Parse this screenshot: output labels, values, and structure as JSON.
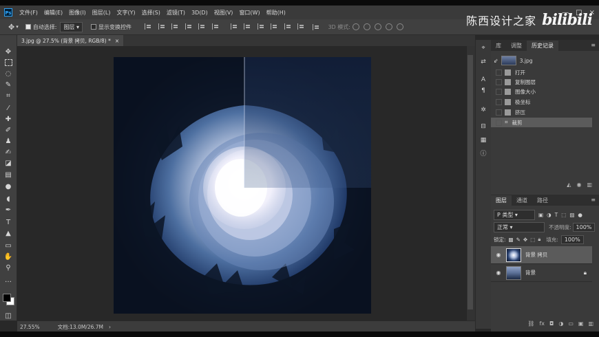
{
  "app": {
    "logo_text": "Ps"
  },
  "menu": [
    "文件(F)",
    "编辑(E)",
    "图像(I)",
    "图层(L)",
    "文字(Y)",
    "选择(S)",
    "滤镜(T)",
    "3D(D)",
    "视图(V)",
    "窗口(W)",
    "帮助(H)"
  ],
  "window_controls": {
    "minimize": "—",
    "maximize": "□",
    "close": "×"
  },
  "options": {
    "auto_select_label": "自动选择:",
    "auto_select_value": "图层",
    "show_transform_label": "显示变换控件",
    "mode_3d_label": "3D 模式:"
  },
  "watermark": {
    "text": "陈西设计之家",
    "logo": "bilibili"
  },
  "document": {
    "tab_title": "3.jpg @ 27.5% (背景 拷贝, RGB/8) *",
    "close": "×",
    "zoom": "27.55%",
    "doc_info": "文档:13.0M/26.7M"
  },
  "history_panel": {
    "tabs": [
      "库",
      "调整",
      "历史记录"
    ],
    "snapshot": "3.jpg",
    "items": [
      {
        "label": "打开"
      },
      {
        "label": "复制图层"
      },
      {
        "label": "图像大小"
      },
      {
        "label": "极坐标"
      },
      {
        "label": "挤压"
      },
      {
        "label": "裁剪"
      }
    ]
  },
  "layers_panel": {
    "tabs": [
      "图层",
      "通道",
      "路径"
    ],
    "filter_kind": "P 类型",
    "blend_mode": "正常",
    "opacity_label": "不透明度:",
    "opacity_value": "100%",
    "lock_label": "锁定:",
    "fill_label": "填充:",
    "fill_value": "100%",
    "layers": [
      {
        "name": "背景 拷贝",
        "selected": true
      },
      {
        "name": "背景",
        "selected": false,
        "locked": true
      }
    ]
  },
  "colors": {
    "selected_row": "#5b5b5b",
    "panel_bg": "#3a3a3a",
    "app_bg": "#282828"
  }
}
